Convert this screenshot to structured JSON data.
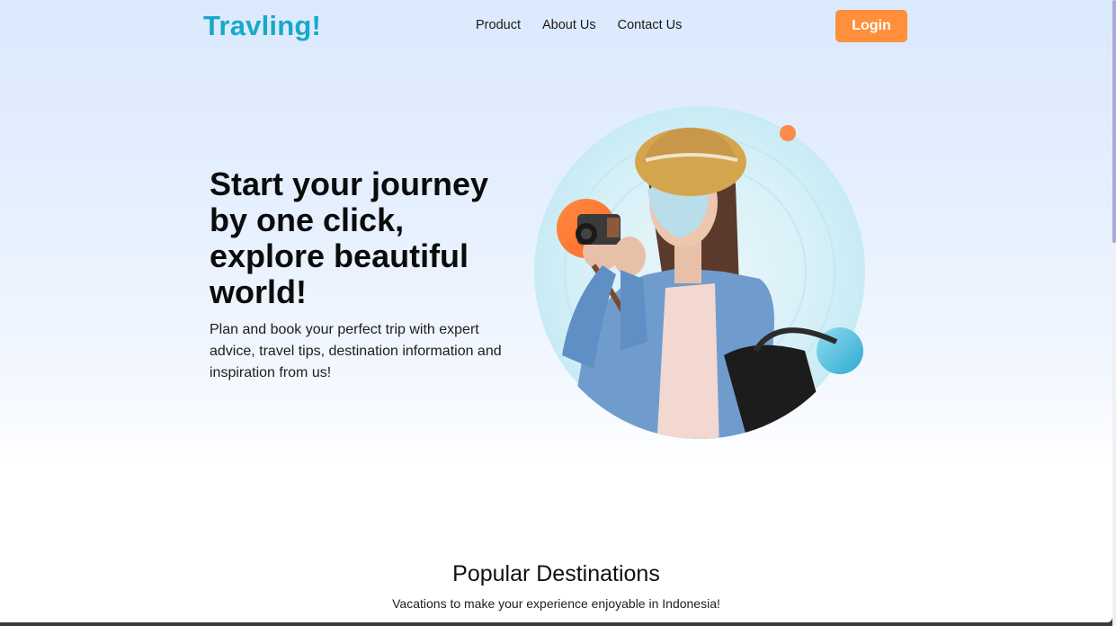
{
  "header": {
    "logo": "Travling!",
    "nav": [
      "Product",
      "About Us",
      "Contact Us"
    ],
    "login_label": "Login"
  },
  "hero": {
    "title": "Start your journey by one click, explore beautiful world!",
    "description": "Plan and book your perfect trip with expert advice, travel tips, destination information and inspiration from us!",
    "image": "traveler-with-camera"
  },
  "section": {
    "title": "Popular Destinations",
    "subtitle": "Vacations to make your experience enjoyable in Indonesia!"
  },
  "colors": {
    "brand": "#17a9c9",
    "accent": "#ff8f3a"
  }
}
